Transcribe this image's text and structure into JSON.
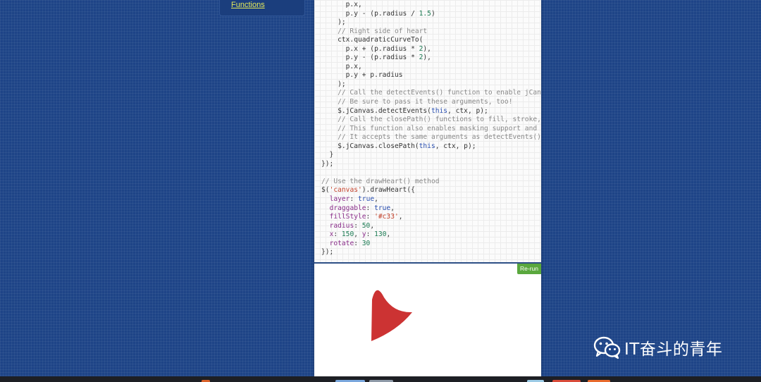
{
  "sidebar": {
    "link_label": "Functions"
  },
  "code_lines": [
    [
      {
        "t": "      p.x,",
        "c": ""
      }
    ],
    [
      {
        "t": "      p.y - (p.radius / ",
        "c": ""
      },
      {
        "t": "1.5",
        "c": "nm"
      },
      {
        "t": ")",
        "c": ""
      }
    ],
    [
      {
        "t": "    );",
        "c": ""
      }
    ],
    [
      {
        "t": "    // Right side of heart",
        "c": "cm"
      }
    ],
    [
      {
        "t": "    ctx.quadraticCurveTo(",
        "c": ""
      }
    ],
    [
      {
        "t": "      p.x + (p.radius * ",
        "c": ""
      },
      {
        "t": "2",
        "c": "nm"
      },
      {
        "t": "),",
        "c": ""
      }
    ],
    [
      {
        "t": "      p.y - (p.radius * ",
        "c": ""
      },
      {
        "t": "2",
        "c": "nm"
      },
      {
        "t": "),",
        "c": ""
      }
    ],
    [
      {
        "t": "      p.x,",
        "c": ""
      }
    ],
    [
      {
        "t": "      p.y + p.radius",
        "c": ""
      }
    ],
    [
      {
        "t": "    );",
        "c": ""
      }
    ],
    [
      {
        "t": "    // Call the detectEvents() function to enable jCanvas",
        "c": "cm"
      }
    ],
    [
      {
        "t": "    // Be sure to pass it these arguments, too!",
        "c": "cm"
      }
    ],
    [
      {
        "t": "    $.jCanvas.detectEvents(",
        "c": ""
      },
      {
        "t": "this",
        "c": "kw"
      },
      {
        "t": ", ctx, p);",
        "c": ""
      }
    ],
    [
      {
        "t": "    // Call the closePath() functions to fill, stroke, and",
        "c": "cm"
      }
    ],
    [
      {
        "t": "    // This function also enables masking support and events",
        "c": "cm"
      }
    ],
    [
      {
        "t": "    // It accepts the same arguments as detectEvents()",
        "c": "cm"
      }
    ],
    [
      {
        "t": "    $.jCanvas.closePath(",
        "c": ""
      },
      {
        "t": "this",
        "c": "kw"
      },
      {
        "t": ", ctx, p);",
        "c": ""
      }
    ],
    [
      {
        "t": "  }",
        "c": ""
      }
    ],
    [
      {
        "t": "});",
        "c": ""
      }
    ],
    [
      {
        "t": "",
        "c": ""
      }
    ],
    [
      {
        "t": "// Use the drawHeart() method",
        "c": "cm"
      }
    ],
    [
      {
        "t": "$(",
        "c": ""
      },
      {
        "t": "'canvas'",
        "c": "st"
      },
      {
        "t": ").drawHeart({",
        "c": ""
      }
    ],
    [
      {
        "t": "  ",
        "c": ""
      },
      {
        "t": "layer",
        "c": "pr"
      },
      {
        "t": ": ",
        "c": ""
      },
      {
        "t": "true",
        "c": "kw"
      },
      {
        "t": ",",
        "c": ""
      }
    ],
    [
      {
        "t": "  ",
        "c": ""
      },
      {
        "t": "draggable",
        "c": "pr"
      },
      {
        "t": ": ",
        "c": ""
      },
      {
        "t": "true",
        "c": "kw"
      },
      {
        "t": ",",
        "c": ""
      }
    ],
    [
      {
        "t": "  ",
        "c": ""
      },
      {
        "t": "fillStyle",
        "c": "pr"
      },
      {
        "t": ": ",
        "c": ""
      },
      {
        "t": "'#c33'",
        "c": "st"
      },
      {
        "t": ",",
        "c": ""
      }
    ],
    [
      {
        "t": "  ",
        "c": ""
      },
      {
        "t": "radius",
        "c": "pr"
      },
      {
        "t": ": ",
        "c": ""
      },
      {
        "t": "50",
        "c": "nm"
      },
      {
        "t": ",",
        "c": ""
      }
    ],
    [
      {
        "t": "  ",
        "c": ""
      },
      {
        "t": "x",
        "c": "pr"
      },
      {
        "t": ": ",
        "c": ""
      },
      {
        "t": "150",
        "c": "nm"
      },
      {
        "t": ", ",
        "c": ""
      },
      {
        "t": "y",
        "c": "pr"
      },
      {
        "t": ": ",
        "c": ""
      },
      {
        "t": "130",
        "c": "nm"
      },
      {
        "t": ",",
        "c": ""
      }
    ],
    [
      {
        "t": "  ",
        "c": ""
      },
      {
        "t": "rotate",
        "c": "pr"
      },
      {
        "t": ": ",
        "c": ""
      },
      {
        "t": "30",
        "c": "nm"
      }
    ],
    [
      {
        "t": "});",
        "c": ""
      }
    ]
  ],
  "output": {
    "rerun_label": "Re-run",
    "heart_color": "#c33"
  },
  "watermark": {
    "text": "IT奋斗的青年"
  },
  "colors": {
    "background": "#1e4487",
    "link": "#e3e85a",
    "rerun": "#5aa83e"
  }
}
